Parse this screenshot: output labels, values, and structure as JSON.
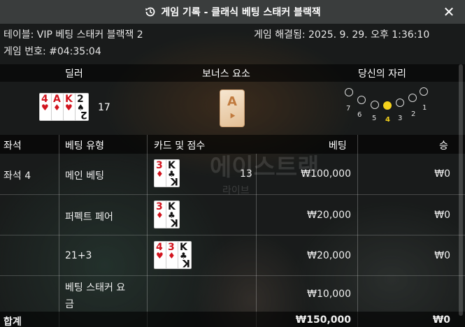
{
  "header": {
    "title": "게임 기록 - 클래식 베팅 스태커 블랙잭",
    "history_icon": "history-icon",
    "close_icon": "close-icon",
    "close_glyph": "✕"
  },
  "info": {
    "table_label": "테이블: VIP 베팅 스태커 블랙잭 2",
    "resolved_label": "게임 해결됨: 2025. 9. 29. 오후 1:36:10",
    "game_number_label": "게임 번호: #04:35:04"
  },
  "summary_headers": {
    "dealer": "딜러",
    "bonus": "보너스 요소",
    "your_seat": "당신의 자리"
  },
  "dealer": {
    "cards": [
      {
        "rank": "4",
        "suit": "♥",
        "color": "#d2141e"
      },
      {
        "rank": "A",
        "suit": "♦",
        "color": "#d2141e"
      },
      {
        "rank": "K",
        "suit": "♥",
        "color": "#d2141e"
      },
      {
        "rank": "2",
        "suit": "♠",
        "color": "#111111"
      }
    ],
    "score": "17"
  },
  "bonus": {
    "rank": "A",
    "mark": "⯈"
  },
  "seats": [
    {
      "label": "7",
      "active": false
    },
    {
      "label": "6",
      "active": false
    },
    {
      "label": "5",
      "active": false
    },
    {
      "label": "4",
      "active": true
    },
    {
      "label": "3",
      "active": false
    },
    {
      "label": "2",
      "active": false
    },
    {
      "label": "1",
      "active": false
    }
  ],
  "columns": {
    "seat": "좌석",
    "bet_type": "베팅 유형",
    "cards_score": "카드 및 점수",
    "bet": "베팅",
    "win": "승"
  },
  "rows": [
    {
      "seat": "좌석 4",
      "bet_type": "메인 베팅",
      "score": "13",
      "bet": "₩100,000",
      "win": "₩0",
      "cards": [
        {
          "rank": "3",
          "suit": "♦",
          "color": "#d2141e"
        },
        {
          "rank": "K",
          "suit": "♣",
          "color": "#111111"
        }
      ]
    },
    {
      "seat": "",
      "bet_type": "퍼펙트 페어",
      "score": "",
      "bet": "₩20,000",
      "win": "₩0",
      "cards": [
        {
          "rank": "3",
          "suit": "♦",
          "color": "#d2141e"
        },
        {
          "rank": "K",
          "suit": "♣",
          "color": "#111111"
        }
      ]
    },
    {
      "seat": "",
      "bet_type": "21+3",
      "score": "",
      "bet": "₩20,000",
      "win": "₩0",
      "cards": [
        {
          "rank": "4",
          "suit": "♥",
          "color": "#d2141e"
        },
        {
          "rank": "3",
          "suit": "♦",
          "color": "#d2141e"
        },
        {
          "rank": "K",
          "suit": "♣",
          "color": "#111111"
        }
      ]
    },
    {
      "seat": "",
      "bet_type_line1": "베팅 스태커 요",
      "bet_type_line2": "금",
      "score": "",
      "bet": "₩10,000",
      "win": ""
    }
  ],
  "total": {
    "label": "합계",
    "bet": "₩150,000",
    "win": "₩0"
  },
  "background": {
    "logo_text": "에이스트랜",
    "logo_sub": "라이브"
  }
}
